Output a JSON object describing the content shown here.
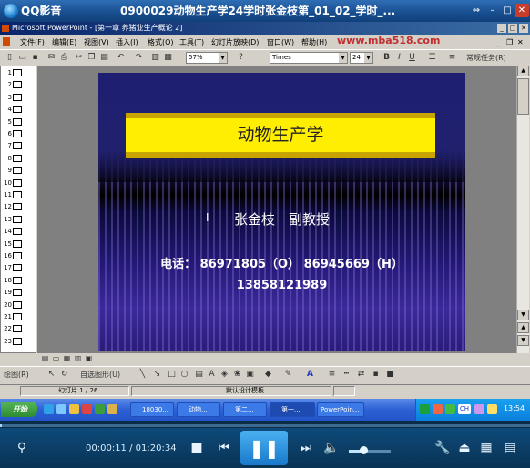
{
  "player": {
    "app_name": "QQ影音",
    "file_title": "0900029动物生产学24学时张金枝第_01_02_学时_...",
    "elapsed": "00:00:11",
    "total": "01:20:34",
    "time_sep": " / ",
    "volume_level": 0.35,
    "progress": 0.002,
    "icons": [
      "footprint-icon",
      "stop-icon",
      "prev-icon",
      "pause-icon",
      "next-icon",
      "speaker-icon",
      "tools-icon",
      "eject-icon",
      "playlist-icon",
      "menu-icon"
    ]
  },
  "ppt": {
    "title": "Microsoft PowerPoint - [第一章 养猪业生产概论 2]",
    "menu": [
      "文件(F)",
      "编辑(E)",
      "视图(V)",
      "插入(I)",
      "格式(O)",
      "工具(T)",
      "幻灯片放映(D)",
      "窗口(W)",
      "帮助(H)"
    ],
    "watermark": "www.mba518.com",
    "zoom": "57%",
    "font": "Times",
    "font_size": "24",
    "bold": "B",
    "italic": "I",
    "underline": "U",
    "design_tasks": "常规任务(R)",
    "slide_numbers": [
      "1",
      "2",
      "3",
      "4",
      "5",
      "6",
      "7",
      "8",
      "9",
      "10",
      "11",
      "12",
      "13",
      "14",
      "15",
      "16",
      "17",
      "18",
      "19",
      "20",
      "21",
      "22",
      "23"
    ],
    "slide": {
      "heading": "动物生产学",
      "author": "张金枝　副教授",
      "phone_line": "电话：  86971805（O） 86945669（H）",
      "phone_line2": "13858121989"
    },
    "draw_label": "绘图(R)",
    "autoshape_label": "自选图形(U)",
    "status_slide": "幻灯片 1 / 26",
    "status_template": "默认设计模板"
  },
  "taskbar": {
    "start": "开始",
    "tasks": [
      "18030...",
      "动物...",
      "第二...",
      "第一...",
      "PowerPoin..."
    ],
    "clock": "13:54",
    "lang": "CH"
  }
}
